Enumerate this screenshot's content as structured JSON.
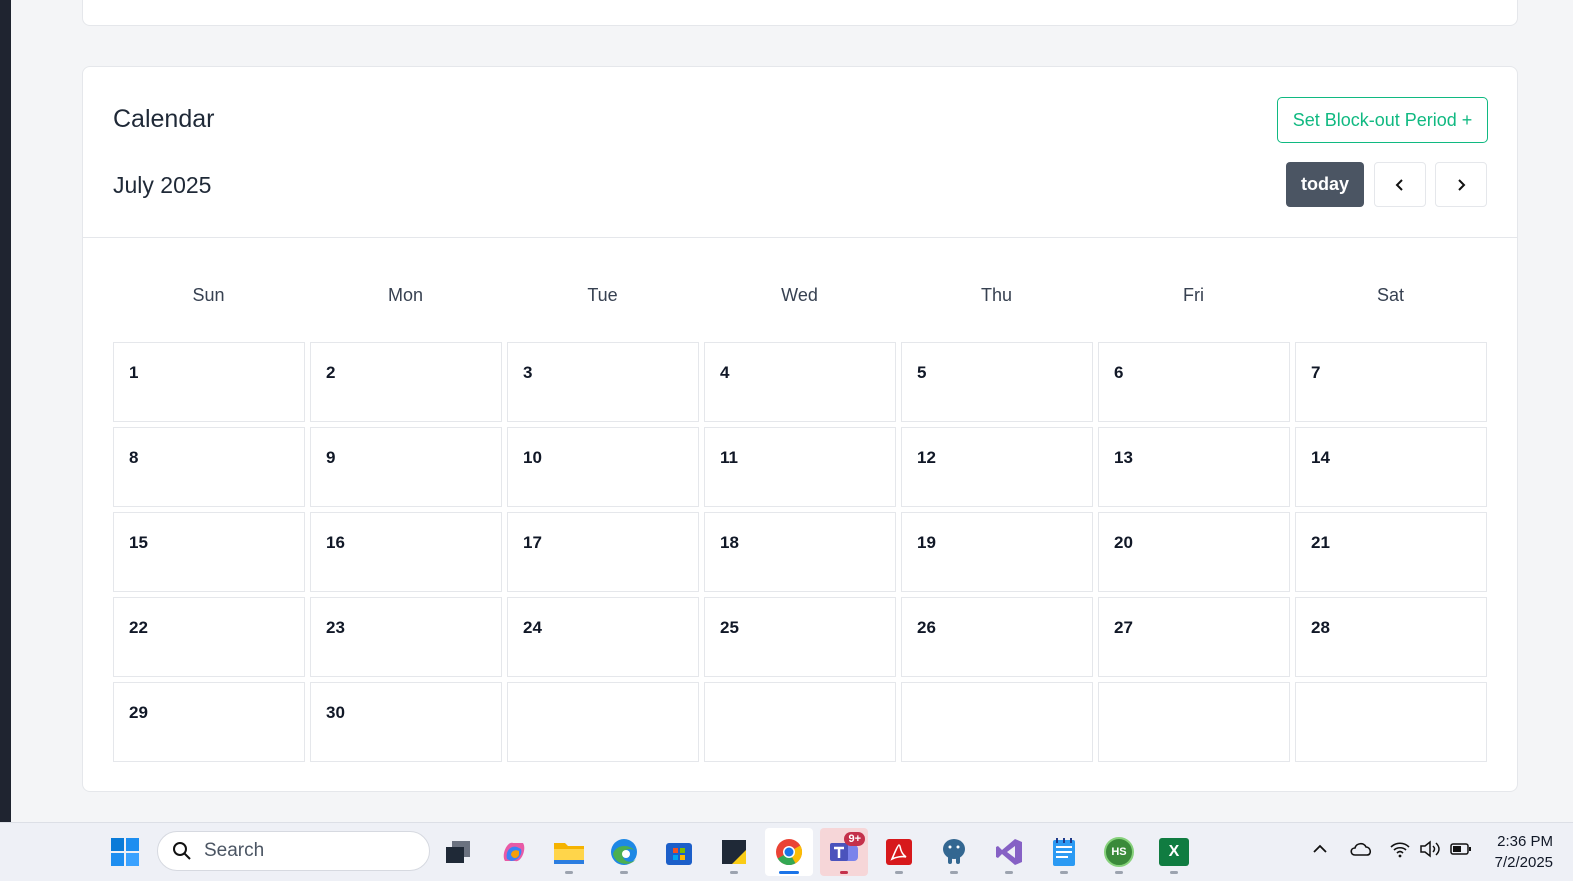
{
  "calendar": {
    "title": "Calendar",
    "block_out_label": "Set Block-out Period +",
    "month_label": "July 2025",
    "today_label": "today",
    "weekdays": [
      "Sun",
      "Mon",
      "Tue",
      "Wed",
      "Thu",
      "Fri",
      "Sat"
    ],
    "weeks": [
      [
        "1",
        "2",
        "3",
        "4",
        "5",
        "6",
        "7"
      ],
      [
        "8",
        "9",
        "10",
        "11",
        "12",
        "13",
        "14"
      ],
      [
        "15",
        "16",
        "17",
        "18",
        "19",
        "20",
        "21"
      ],
      [
        "22",
        "23",
        "24",
        "25",
        "26",
        "27",
        "28"
      ],
      [
        "29",
        "30",
        "",
        "",
        "",
        "",
        ""
      ]
    ],
    "accent_color": "#10b981",
    "today_button_color": "#4b5563"
  },
  "taskbar": {
    "search_placeholder": "Search",
    "teams_badge": "9+",
    "time": "2:36 PM",
    "date": "7/2/2025",
    "apps": [
      "windows-start-icon",
      "task-view-icon",
      "copilot-icon",
      "file-explorer-icon",
      "edge-icon",
      "store-icon",
      "sticky-notes-icon",
      "chrome-icon",
      "teams-icon",
      "acrobat-icon",
      "postgres-icon",
      "visual-studio-icon",
      "notepad-icon",
      "hs-app-icon",
      "excel-icon"
    ],
    "tray": [
      "chevron-up-icon",
      "onedrive-icon",
      "wifi-icon",
      "volume-icon",
      "battery-icon"
    ],
    "excel_label": "X",
    "hs_label": "HS"
  }
}
